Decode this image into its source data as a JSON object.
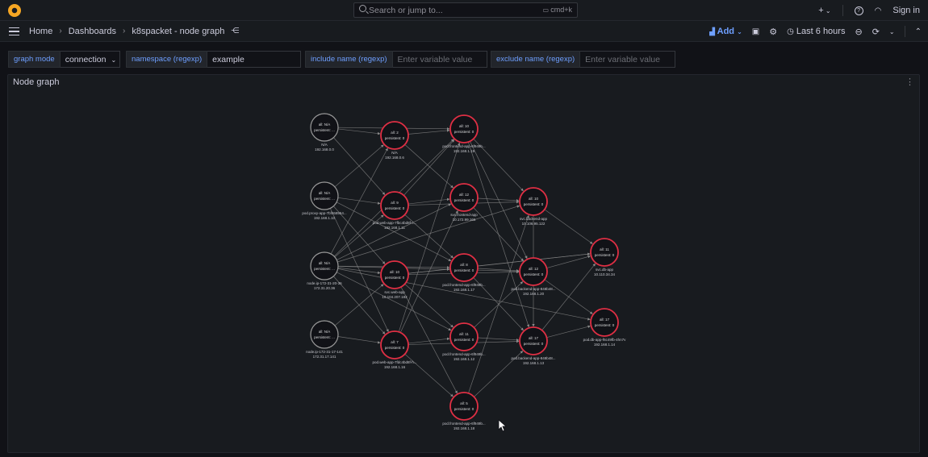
{
  "topbar": {
    "search_placeholder": "Search or jump to...",
    "search_shortcut": "cmd+k",
    "plus_label": "+",
    "help_icon": "?",
    "signin_label": "Sign in"
  },
  "breadcrumb": {
    "home": "Home",
    "dashboards": "Dashboards",
    "current": "k8spacket - node graph"
  },
  "toolbar": {
    "add_label": "Add",
    "time_range": "Last 6 hours"
  },
  "variables": [
    {
      "label": "graph mode",
      "value": "connection",
      "placeholder": ""
    },
    {
      "label": "namespace (regexp)",
      "value": "example",
      "placeholder": ""
    },
    {
      "label": "include name (regexp)",
      "value": "",
      "placeholder": "Enter variable value"
    },
    {
      "label": "exclude name (regexp)",
      "value": "",
      "placeholder": "Enter variable value"
    }
  ],
  "panel": {
    "title": "Node graph"
  },
  "colors": {
    "accent": "#6e9fff",
    "node_error": "#e02f44",
    "node_neutral": "#9a9a9a",
    "edge": "#8a8a8a",
    "background": "#111217",
    "panel": "#181b1f"
  },
  "graph": {
    "nodes": [
      {
        "id": "n1",
        "line1": "all: N/A",
        "line2": "persistent: ...",
        "name": "N/A",
        "ip": "192.168.0.0",
        "status": "neutral"
      },
      {
        "id": "n2",
        "line1": "all: N/A",
        "line2": "persistent: ...",
        "name": "pod.proxy-app-7bf468554...",
        "ip": "192.168.1.10",
        "status": "neutral"
      },
      {
        "id": "n3",
        "line1": "all: N/A",
        "line2": "persistent: ...",
        "name": "node.ip-172-31-20-36",
        "ip": "172.31.20.36",
        "status": "neutral"
      },
      {
        "id": "n4",
        "line1": "all: N/A",
        "line2": "persistent: ...",
        "name": "node.ip-172-31-17-141",
        "ip": "172.31.17.141",
        "status": "neutral"
      },
      {
        "id": "n5",
        "line1": "all: 2",
        "line2": "persistent: 0",
        "name": "N/A",
        "ip": "192.168.0.6",
        "status": "error"
      },
      {
        "id": "n6",
        "line1": "all: 9",
        "line2": "persistent: 0",
        "name": "pod.web-app-7fbc4bd8f-c...",
        "ip": "192.168.1.11",
        "status": "error"
      },
      {
        "id": "n7",
        "line1": "all: 10",
        "line2": "persistent: 0",
        "name": "svc.web-app",
        "ip": "10.104.207.182",
        "status": "error"
      },
      {
        "id": "n8",
        "line1": "all: 7",
        "line2": "persistent: 0",
        "name": "pod.web-app-7fdc4bd8f-h...",
        "ip": "192.168.1.16",
        "status": "error"
      },
      {
        "id": "n9",
        "line1": "all: 10",
        "line2": "persistent: 0",
        "name": "pod.frontend-app-6f949b...",
        "ip": "192.168.1.19",
        "status": "error"
      },
      {
        "id": "n10",
        "line1": "all: 12",
        "line2": "persistent: 0",
        "name": "svc.frontend-app",
        "ip": "10.172.99.166",
        "status": "error"
      },
      {
        "id": "n11",
        "line1": "all: 8",
        "line2": "persistent: 0",
        "name": "pod.frontend-app-6f949b...",
        "ip": "192.168.1.17",
        "status": "error"
      },
      {
        "id": "n12",
        "line1": "all: 11",
        "line2": "persistent: 0",
        "name": "pod.frontend-app-6f949b...",
        "ip": "192.168.1.12",
        "status": "error"
      },
      {
        "id": "n13",
        "line1": "all: 5",
        "line2": "persistent: 0",
        "name": "pod.frontend-app-6f949b...",
        "ip": "192.168.1.18",
        "status": "error"
      },
      {
        "id": "n14",
        "line1": "all: 10",
        "line2": "persistent: 0",
        "name": "svc.backend-app",
        "ip": "10.106.95.122",
        "status": "error"
      },
      {
        "id": "n15",
        "line1": "all: 12",
        "line2": "persistent: 0",
        "name": "pod.backend-app-848b48...",
        "ip": "192.168.1.20",
        "status": "error"
      },
      {
        "id": "n16",
        "line1": "all: 17",
        "line2": "persistent: 0",
        "name": "pod.backend-app-848b48...",
        "ip": "192.168.1.13",
        "status": "error"
      },
      {
        "id": "n17",
        "line1": "all: 11",
        "line2": "persistent: 0",
        "name": "svc.db-app",
        "ip": "10.110.34.34",
        "status": "error"
      },
      {
        "id": "n18",
        "line1": "all: 17",
        "line2": "persistent: 0",
        "name": "pod.db-app-f6c49fb-4hn7v",
        "ip": "192.168.1.14",
        "status": "error"
      }
    ],
    "edges": [
      [
        "n1",
        "n5"
      ],
      [
        "n1",
        "n9"
      ],
      [
        "n1",
        "n6"
      ],
      [
        "n2",
        "n5"
      ],
      [
        "n2",
        "n6"
      ],
      [
        "n2",
        "n7"
      ],
      [
        "n2",
        "n8"
      ],
      [
        "n2",
        "n11"
      ],
      [
        "n3",
        "n5"
      ],
      [
        "n3",
        "n6"
      ],
      [
        "n3",
        "n7"
      ],
      [
        "n3",
        "n8"
      ],
      [
        "n3",
        "n10"
      ],
      [
        "n3",
        "n11"
      ],
      [
        "n3",
        "n12"
      ],
      [
        "n3",
        "n14"
      ],
      [
        "n3",
        "n15"
      ],
      [
        "n3",
        "n9"
      ],
      [
        "n3",
        "n18"
      ],
      [
        "n4",
        "n7"
      ],
      [
        "n4",
        "n8"
      ],
      [
        "n5",
        "n9"
      ],
      [
        "n5",
        "n10"
      ],
      [
        "n6",
        "n10"
      ],
      [
        "n6",
        "n9"
      ],
      [
        "n6",
        "n11"
      ],
      [
        "n6",
        "n14"
      ],
      [
        "n7",
        "n11"
      ],
      [
        "n7",
        "n12"
      ],
      [
        "n7",
        "n13"
      ],
      [
        "n7",
        "n15"
      ],
      [
        "n7",
        "n17"
      ],
      [
        "n8",
        "n9"
      ],
      [
        "n8",
        "n10"
      ],
      [
        "n8",
        "n12"
      ],
      [
        "n8",
        "n13"
      ],
      [
        "n8",
        "n16"
      ],
      [
        "n9",
        "n14"
      ],
      [
        "n9",
        "n15"
      ],
      [
        "n9",
        "n16"
      ],
      [
        "n10",
        "n14"
      ],
      [
        "n10",
        "n15"
      ],
      [
        "n11",
        "n15"
      ],
      [
        "n11",
        "n16"
      ],
      [
        "n11",
        "n17"
      ],
      [
        "n12",
        "n16"
      ],
      [
        "n12",
        "n15"
      ],
      [
        "n13",
        "n16"
      ],
      [
        "n13",
        "n14"
      ],
      [
        "n14",
        "n16"
      ],
      [
        "n15",
        "n17"
      ],
      [
        "n15",
        "n18"
      ],
      [
        "n16",
        "n17"
      ],
      [
        "n16",
        "n18"
      ],
      [
        "n14",
        "n17"
      ]
    ]
  }
}
